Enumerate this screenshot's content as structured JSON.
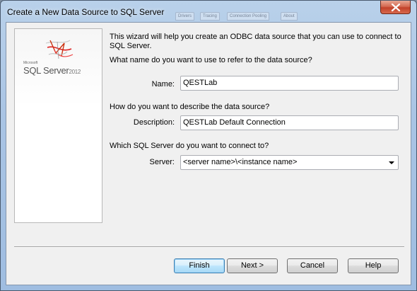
{
  "window": {
    "title": "Create a New Data Source to SQL Server"
  },
  "background_tabs": [
    "Drivers",
    "Tracing",
    "Connection Pooling",
    "About"
  ],
  "logo": {
    "brand": "Microsoft",
    "product": "SQL Server",
    "version": "2012"
  },
  "intro": {
    "line1": "This wizard will help you create an ODBC data source that you can use to connect to",
    "line2": "SQL Server."
  },
  "name_section": {
    "question": "What name do you want to use to refer to the data source?",
    "label": "Name:",
    "value": "QESTLab"
  },
  "description_section": {
    "question": "How do you want to describe the data source?",
    "label": "Description:",
    "value": "QESTLab Default Connection"
  },
  "server_section": {
    "question": "Which SQL Server do you want to connect to?",
    "label": "Server:",
    "value": "<server name>\\<instance name>"
  },
  "buttons": {
    "finish": "Finish",
    "next": "Next >",
    "cancel": "Cancel",
    "help": "Help"
  },
  "colors": {
    "title_bar": "#a9c4e4",
    "close_button": "#c2412a",
    "dialog_bg": "#f0f0f0",
    "default_button": "#bee6fd"
  }
}
